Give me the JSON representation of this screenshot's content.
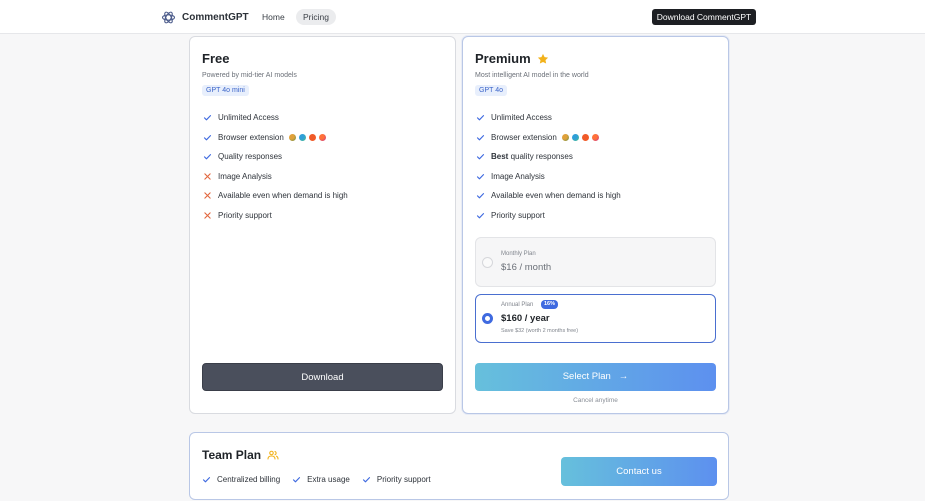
{
  "nav": {
    "brand": "CommentGPT",
    "links": [
      "Home",
      "Pricing"
    ],
    "download_label": "Download CommentGPT"
  },
  "free": {
    "title": "Free",
    "subtitle": "Powered by mid-tier AI models",
    "badge": "GPT 4o mini",
    "features": [
      {
        "text": "Unlimited Access",
        "included": true
      },
      {
        "text": "Browser extension",
        "included": true,
        "browsers": true
      },
      {
        "text": "Quality responses",
        "included": true
      },
      {
        "text": "Image Analysis",
        "included": false
      },
      {
        "text": "Available even when demand is high",
        "included": false
      },
      {
        "text": "Priority support",
        "included": false
      }
    ],
    "button_label": "Download"
  },
  "premium": {
    "title": "Premium",
    "subtitle": "Most intelligent AI model in the world",
    "badge": "GPT 4o",
    "features": [
      {
        "text": "Unlimited Access",
        "included": true
      },
      {
        "text": "Browser extension",
        "included": true,
        "browsers": true
      },
      {
        "bold": "Best",
        "text": " quality responses",
        "included": true
      },
      {
        "text": "Image Analysis",
        "included": true
      },
      {
        "text": "Available even when demand is high",
        "included": true
      },
      {
        "text": "Priority support",
        "included": true
      }
    ],
    "monthly": {
      "label": "Monthly Plan",
      "price": "$16 / month",
      "selected": false
    },
    "annual": {
      "label": "Annual Plan",
      "discount": "16%",
      "price": "$160 / year",
      "note": "Save $32 (worth 2 months free)",
      "selected": true
    },
    "button_label": "Select Plan",
    "arrow": "→",
    "cancel_text": "Cancel anytime"
  },
  "team": {
    "title": "Team Plan",
    "features": [
      "Centralized billing",
      "Extra usage",
      "Priority support"
    ],
    "button_label": "Contact us"
  },
  "colors": {
    "check": "#3f6ae0",
    "cross": "#e2673f",
    "star": "#f2b21b",
    "accent_blue": "#3f6ae0"
  },
  "icons": {
    "brand": "commentgpt-logo-icon",
    "star": "star-icon",
    "team": "people-icon",
    "check": "check-icon",
    "cross": "cross-icon",
    "browsers": [
      "chrome-icon",
      "edge-icon",
      "brave-icon",
      "firefox-icon"
    ]
  }
}
